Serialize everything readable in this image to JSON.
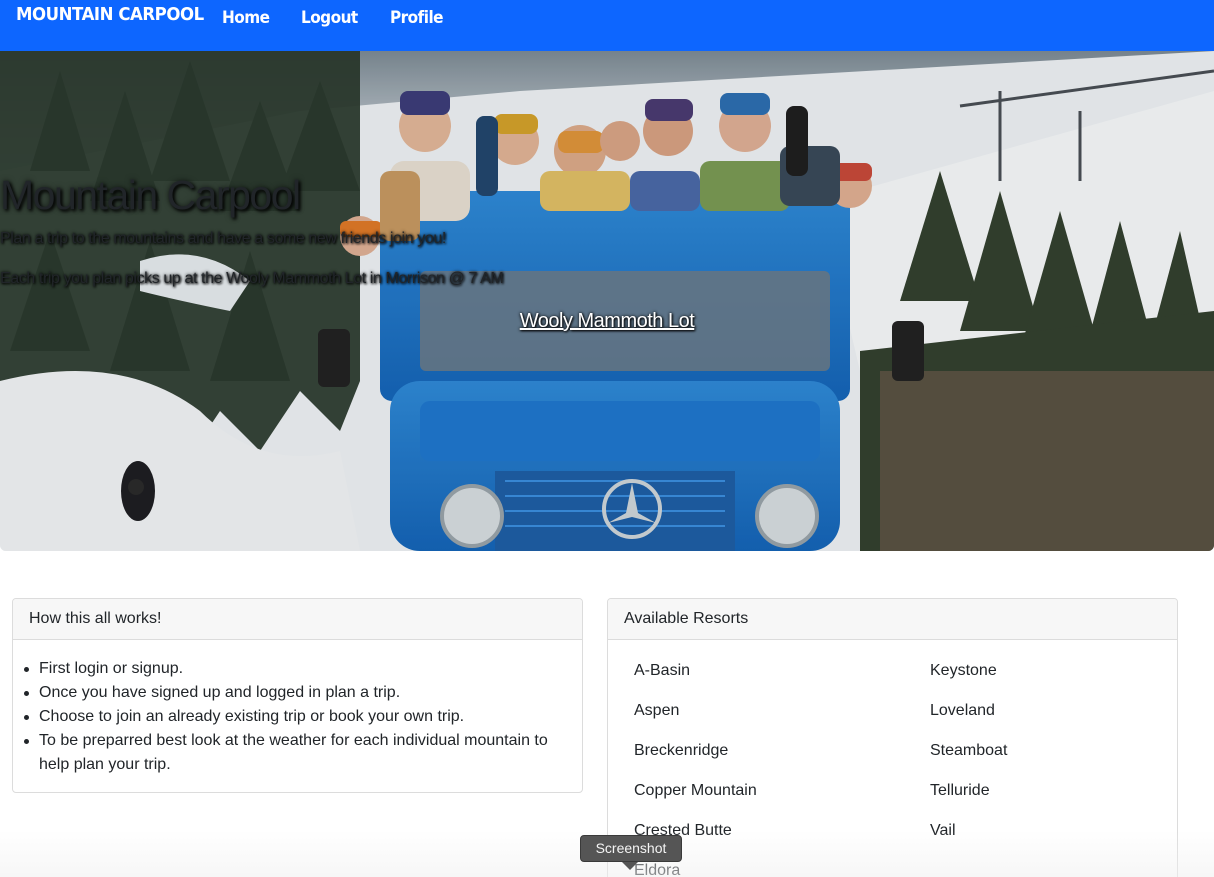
{
  "navbar": {
    "brand": "MOUNTAIN CARPOOL",
    "links": [
      "Home",
      "Logout",
      "Profile"
    ],
    "color": "#0d66ff"
  },
  "hero": {
    "title": "Mountain Carpool",
    "subtitle": "Plan a trip to the mountains and have a some new friends join you!",
    "info": "Each trip you plan picks up at the Wooly Mammoth Lot in Morrison @ 7 AM",
    "link": "Wooly Mammoth Lot",
    "image": "skiers-on-blue-mercedes-unimog-truck-photo"
  },
  "how": {
    "header": "How this all works!",
    "items": [
      "First login or signup.",
      "Once you have signed up and logged in plan a trip.",
      "Choose to join an already existing trip or book your own trip.",
      "To be preparred best look at the weather for each individual mountain to help plan your trip."
    ]
  },
  "resorts": {
    "header": "Available Resorts",
    "items": [
      "A-Basin",
      "Keystone",
      "Aspen",
      "Loveland",
      "Breckenridge",
      "Steamboat",
      "Copper Mountain",
      "Telluride",
      "Crested Butte",
      "Vail",
      "Eldora"
    ]
  },
  "tooltip": {
    "text": "Screenshot"
  }
}
